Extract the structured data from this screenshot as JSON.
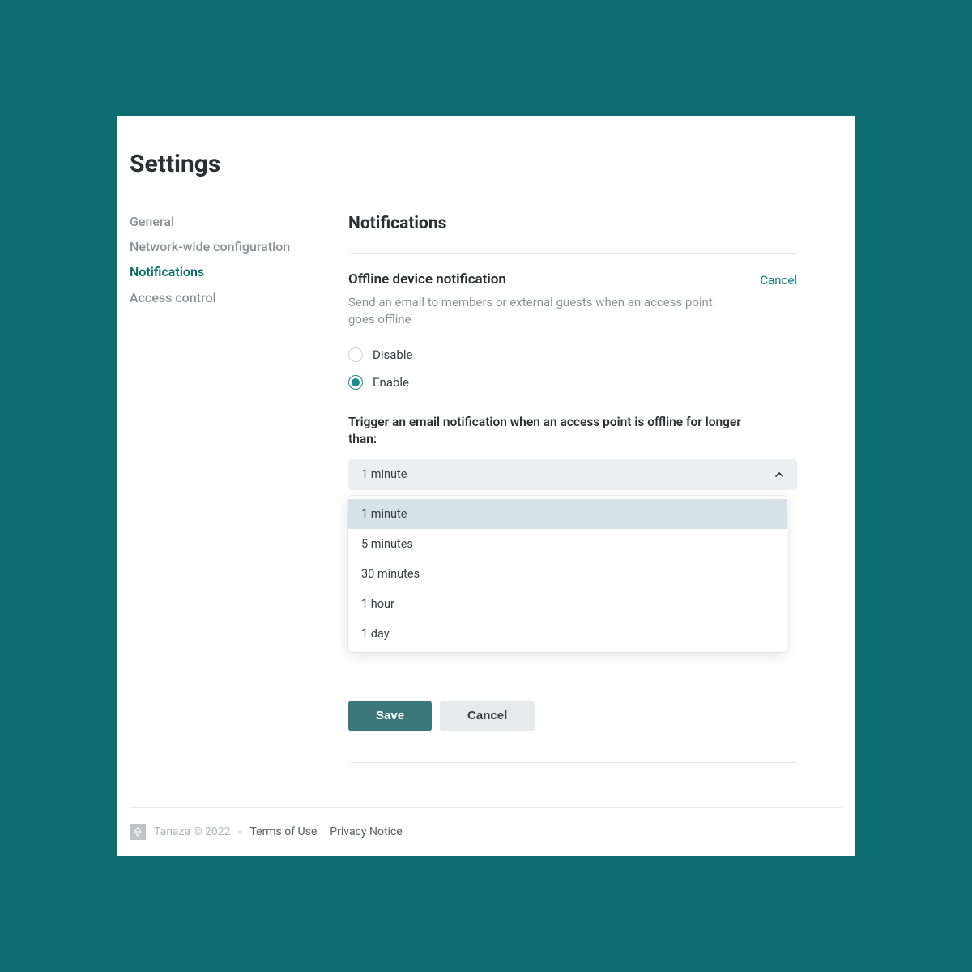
{
  "page": {
    "title": "Settings"
  },
  "sidebar": {
    "items": [
      {
        "label": "General"
      },
      {
        "label": "Network-wide configuration"
      },
      {
        "label": "Notifications"
      },
      {
        "label": "Access control"
      }
    ]
  },
  "main": {
    "section_title": "Notifications",
    "offline": {
      "title": "Offline device notification",
      "cancel": "Cancel",
      "description": "Send an email to members or external guests when an access point goes offline",
      "radios": {
        "disable": "Disable",
        "enable": "Enable"
      },
      "trigger_label": "Trigger an email notification when an access point is offline for longer than:",
      "select": {
        "value": "1 minute",
        "options": [
          "1 minute",
          "5 minutes",
          "30 minutes",
          "1 hour",
          "1 day"
        ]
      }
    },
    "buttons": {
      "save": "Save",
      "cancel": "Cancel"
    }
  },
  "footer": {
    "copyright": "Tanaza © 2022",
    "sep": "-",
    "terms": "Terms of Use",
    "privacy": "Privacy Notice"
  }
}
